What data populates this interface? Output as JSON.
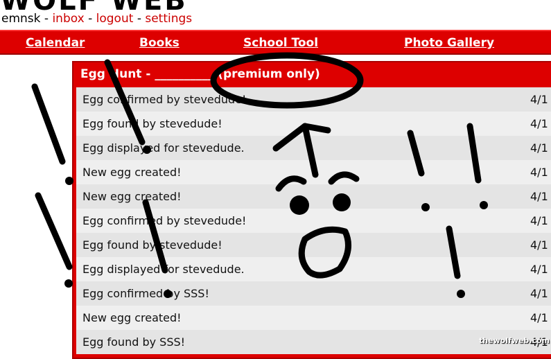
{
  "header": {
    "logo_text": "WOLF WEB",
    "username": "emnsk",
    "links": [
      "inbox",
      "logout",
      "settings"
    ]
  },
  "nav": {
    "items": [
      "Calendar",
      "Books",
      "School Tool",
      "Photo Gallery"
    ]
  },
  "panel": {
    "title": "Egg Hunt - __________ (premium only)",
    "rows": [
      {
        "text": "Egg confirmed by stevedude!",
        "date": "4/1"
      },
      {
        "text": "Egg found by stevedude!",
        "date": "4/1"
      },
      {
        "text": "Egg displayed for stevedude.",
        "date": "4/1"
      },
      {
        "text": "New egg created!",
        "date": "4/1"
      },
      {
        "text": "New egg created!",
        "date": "4/1"
      },
      {
        "text": "Egg confirmed by stevedude!",
        "date": "4/1"
      },
      {
        "text": "Egg found by stevedude!",
        "date": "4/1"
      },
      {
        "text": "Egg displayed for stevedude.",
        "date": "4/1"
      },
      {
        "text": "Egg confirmed by SSS!",
        "date": "4/1"
      },
      {
        "text": "New egg created!",
        "date": "4/1"
      },
      {
        "text": "Egg found by SSS!",
        "date": "4/1"
      }
    ]
  },
  "watermark": "thewolfweb.com",
  "colors": {
    "nav_red": "#dd0000",
    "link_red": "#cc0000",
    "row_light": "#efefef",
    "row_dark": "#e4e4e4"
  }
}
